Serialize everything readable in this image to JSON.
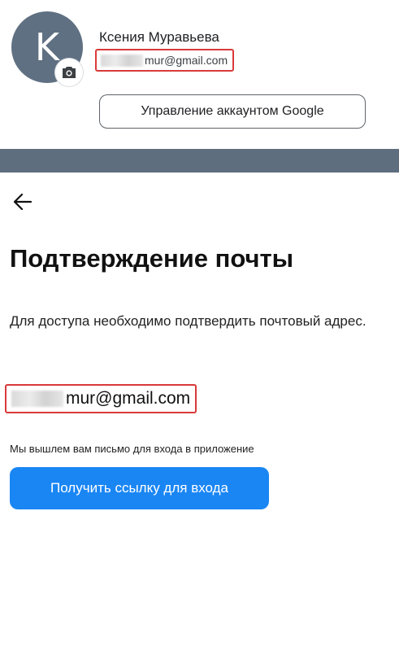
{
  "account": {
    "avatar_letter": "K",
    "name": "Ксения Муравьева",
    "email_visible": "mur@gmail.com",
    "manage_label": "Управление аккаунтом Google",
    "camera_icon": "camera-icon"
  },
  "verify": {
    "title": "Подтверждение почты",
    "description": "Для доступа необходимо подтвердить почтовый адрес.",
    "email_visible": "mur@gmail.com",
    "hint": "Мы вышлем вам письмо для входа в приложение",
    "button_label": "Получить ссылку для входа",
    "back_icon": "arrow-left-icon"
  },
  "colors": {
    "accent_button": "#1a86f4",
    "highlight_border": "#d93a3a",
    "avatar_bg": "#5f7082",
    "band": "#5e6e7e"
  }
}
